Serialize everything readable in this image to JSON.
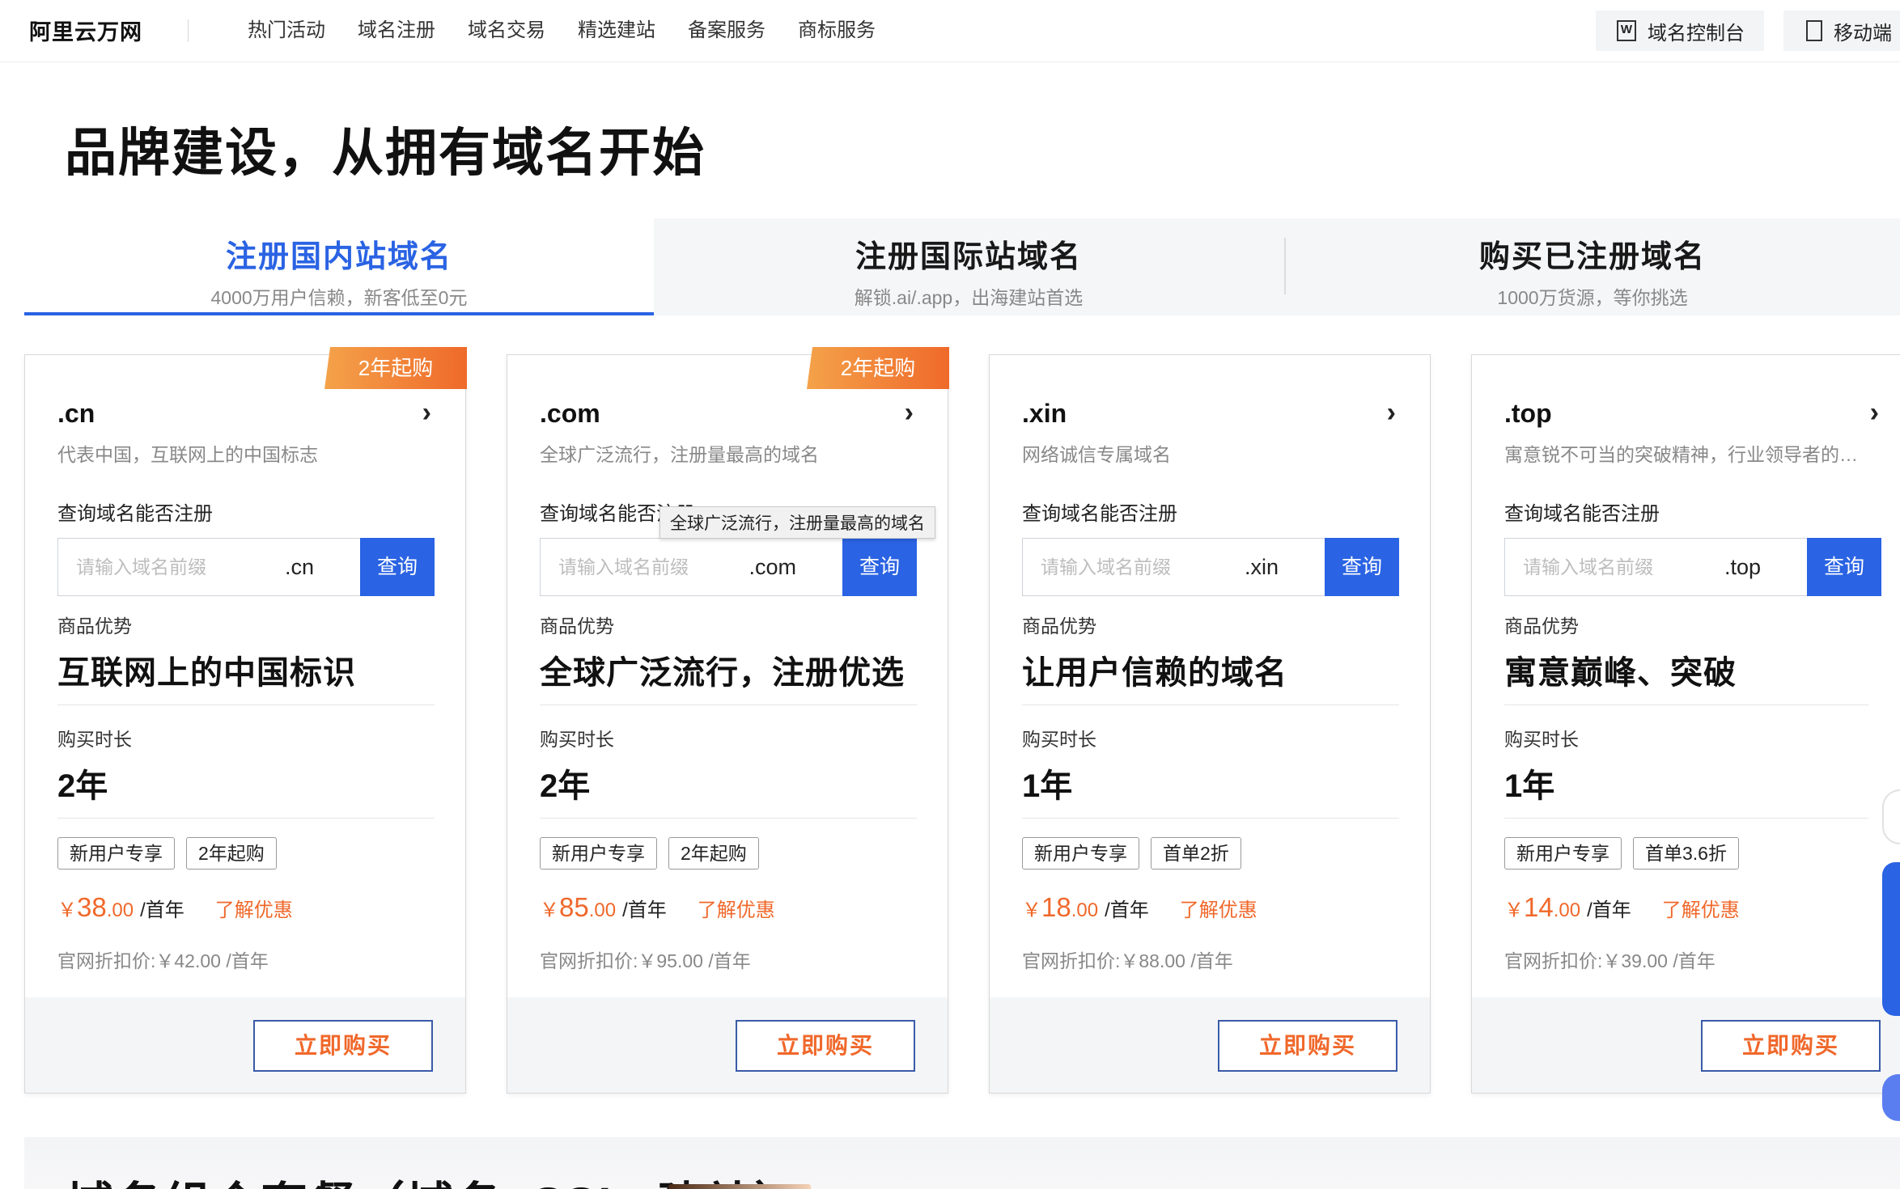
{
  "header": {
    "logo": "阿里云万网",
    "nav": [
      "热门活动",
      "域名注册",
      "域名交易",
      "精选建站",
      "备案服务",
      "商标服务"
    ],
    "console_label": "域名控制台",
    "console_icon": "W",
    "mobile_label": "移动端"
  },
  "hero": {
    "title": "品牌建设，从拥有域名开始"
  },
  "tabs": [
    {
      "title": "注册国内站域名",
      "sub": "4000万用户信赖，新客低至0元"
    },
    {
      "title": "注册国际站域名",
      "sub": "解锁.ai/.app，出海建站首选"
    },
    {
      "title": "购买已注册域名",
      "sub": "1000万货源，等你挑选"
    }
  ],
  "common": {
    "query_label": "查询域名能否注册",
    "placeholder": "请输入域名前缀",
    "query_btn": "查询",
    "adv_label": "商品优势",
    "dur_label": "购买时长",
    "per_year": "/首年",
    "learn_more": "了解优惠",
    "buy_btn": "立即购买",
    "accent": "#2a63e3",
    "price_color": "#f0682b"
  },
  "cards": [
    {
      "ribbon": "2年起购",
      "ext": ".cn",
      "desc": "代表中国，互联网上的中国标志",
      "suffix": ".cn",
      "advantage": "互联网上的中国标识",
      "duration": "2年",
      "tags": [
        "新用户专享",
        "2年起购"
      ],
      "cur": "￥",
      "price_int": "38",
      "price_dec": ".00",
      "official": "官网折扣价:￥42.00 /首年"
    },
    {
      "ribbon": "2年起购",
      "ext": ".com",
      "desc": "全球广泛流行，注册量最高的域名",
      "suffix": ".com",
      "advantage": "全球广泛流行，注册优选",
      "duration": "2年",
      "tags": [
        "新用户专享",
        "2年起购"
      ],
      "cur": "￥",
      "price_int": "85",
      "price_dec": ".00",
      "official": "官网折扣价:￥95.00 /首年"
    },
    {
      "ribbon": "",
      "ext": ".xin",
      "desc": "网络诚信专属域名",
      "suffix": ".xin",
      "advantage": "让用户信赖的域名",
      "duration": "1年",
      "tags": [
        "新用户专享",
        "首单2折"
      ],
      "cur": "￥",
      "price_int": "18",
      "price_dec": ".00",
      "official": "官网折扣价:￥88.00 /首年"
    },
    {
      "ribbon": "",
      "ext": ".top",
      "desc": "寓意锐不可当的突破精神，行业领导者的首选",
      "suffix": ".top",
      "advantage": "寓意巅峰、突破",
      "duration": "1年",
      "tags": [
        "新用户专享",
        "首单3.6折"
      ],
      "cur": "￥",
      "price_int": "14",
      "price_dec": ".00",
      "official": "官网折扣价:￥39.00 /首年"
    }
  ],
  "tooltip": "全球广泛流行，注册量最高的域名",
  "bottom": {
    "title": "域名组合套餐（域名+SSL+建站）"
  }
}
